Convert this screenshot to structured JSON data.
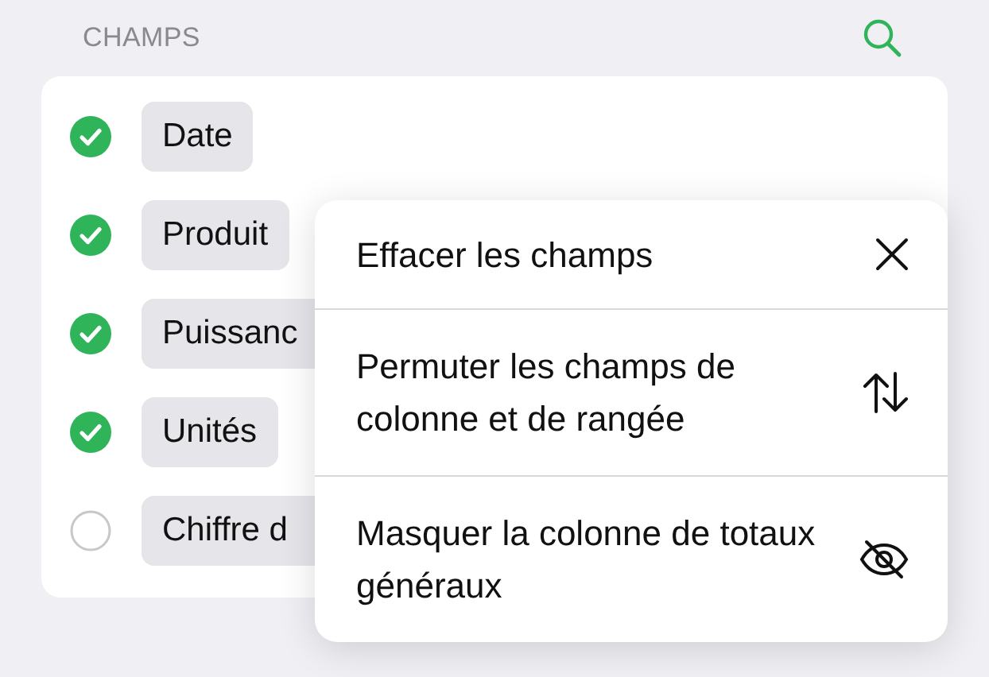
{
  "header": {
    "title": "CHAMPS"
  },
  "fields": [
    {
      "label": "Date",
      "checked": true
    },
    {
      "label": "Produit",
      "checked": true
    },
    {
      "label": "Puissanc",
      "checked": true
    },
    {
      "label": "Unités",
      "checked": true
    },
    {
      "label": "Chiffre d",
      "checked": false
    }
  ],
  "menu": {
    "items": [
      {
        "label": "Effacer les champs",
        "kind": "close"
      },
      {
        "label": "Permuter les champs de colonne et de rangée",
        "kind": "swap"
      },
      {
        "label": "Masquer la colonne de totaux généraux",
        "kind": "hide"
      }
    ]
  }
}
